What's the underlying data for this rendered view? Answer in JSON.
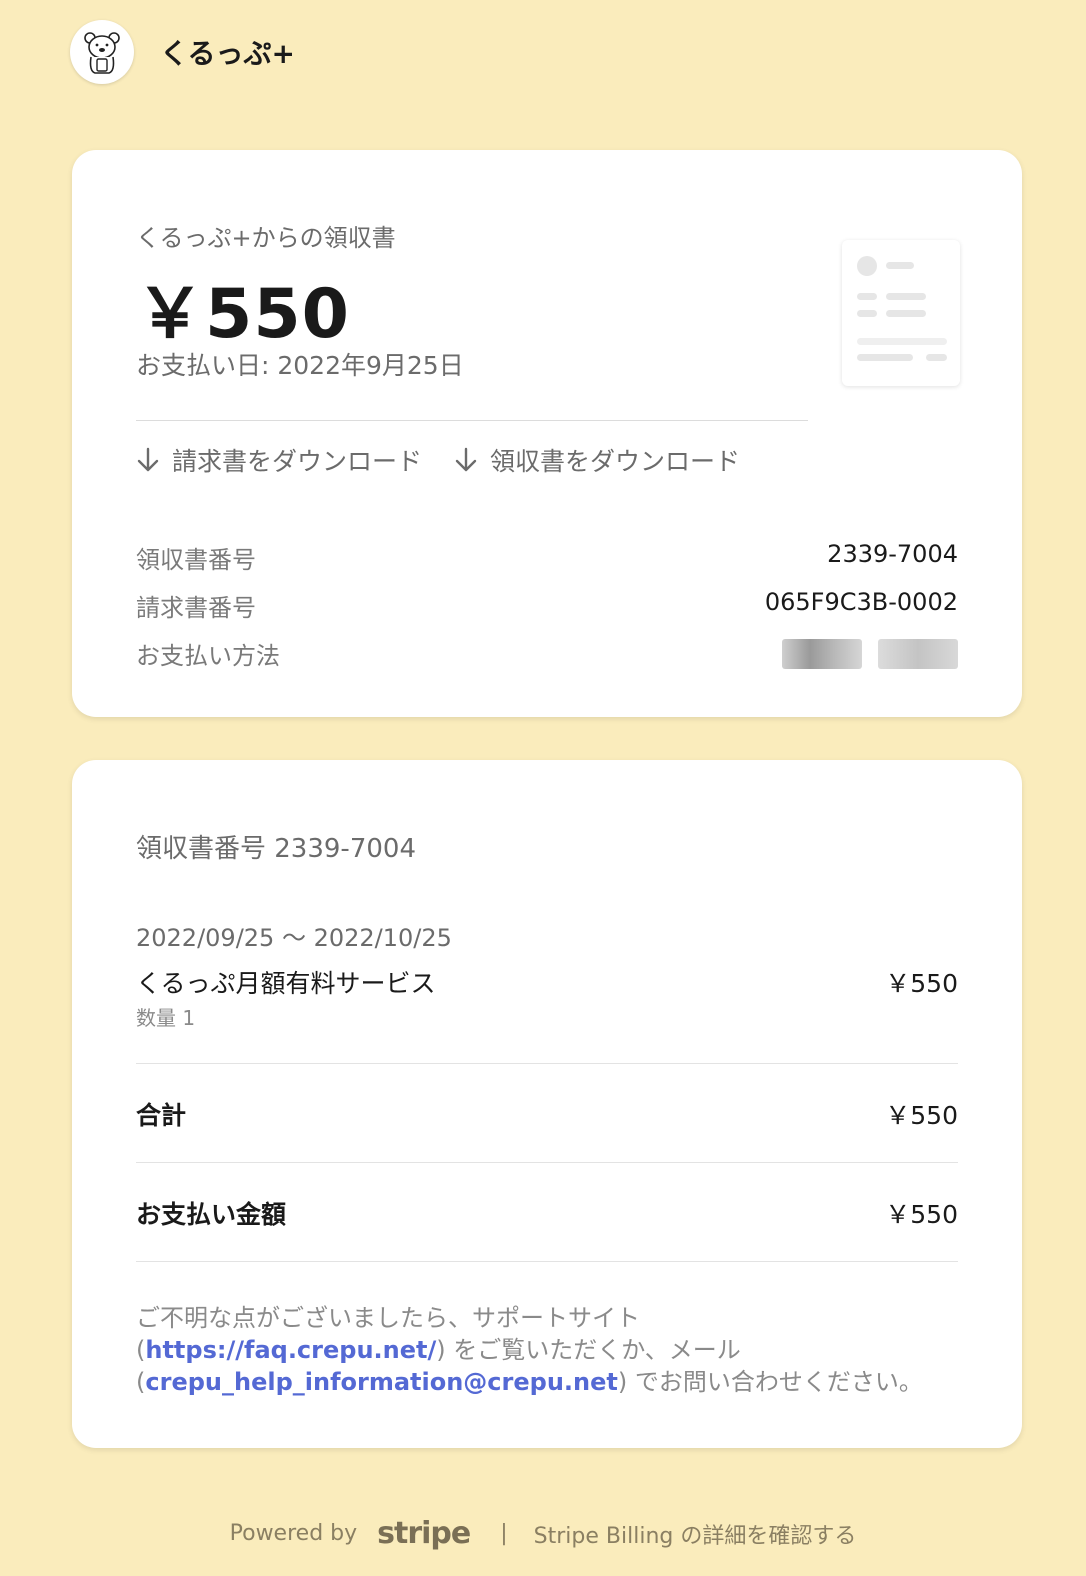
{
  "header": {
    "brand": "くるっぷ+"
  },
  "receipt": {
    "from": "くるっぷ+からの領収書",
    "amount": "￥550",
    "paid_date": "お支払い日: 2022年9月25日",
    "download_invoice": "請求書をダウンロード",
    "download_receipt": "領収書をダウンロード",
    "details": [
      {
        "label": "領収書番号",
        "value": "2339-7004"
      },
      {
        "label": "請求書番号",
        "value": "065F9C3B-0002"
      },
      {
        "label": "お支払い方法",
        "value": ""
      }
    ]
  },
  "summary": {
    "title": "領収書番号 2339-7004",
    "period": "2022/09/25 ～ 2022/10/25",
    "item_name": "くるっぷ月額有料サービス",
    "item_price": "￥550",
    "qty": "数量 1",
    "total_label": "合計",
    "total_value": "￥550",
    "paid_label": "お支払い金額",
    "paid_value": "￥550",
    "support_pre": "ご不明な点がございましたら、サポートサイト",
    "support_open1": "(",
    "support_url": "https://faq.crepu.net/",
    "support_mid": ") をご覧いただくか、メール",
    "support_open2": "(",
    "support_email": "crepu_help_information@crepu.net",
    "support_post": ") でお問い合わせください。"
  },
  "footer": {
    "powered_by": "Powered by",
    "stripe": "stripe",
    "separator": "|",
    "billing_link": "Stripe Billing の詳細を確認する"
  },
  "colors": {
    "background": "#faecbc",
    "link": "#5469d4"
  }
}
